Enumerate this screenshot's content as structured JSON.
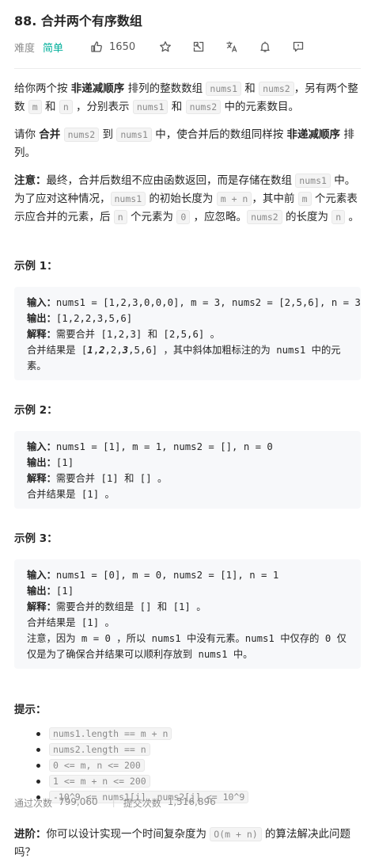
{
  "problem": {
    "title": "88. 合并两个有序数组",
    "difficulty_label": "难度",
    "difficulty": "简单",
    "likes": "1650"
  },
  "desc": {
    "p1": [
      "给你两个按 ",
      "非递减顺序",
      " 排列的整数数组 ",
      "nums1",
      " 和 ",
      "nums2",
      "，另有两个整数 ",
      "m",
      " 和 ",
      "n",
      " ，分别表示 ",
      "nums1",
      " 和 ",
      "nums2",
      " 中的元素数目。"
    ],
    "p2": [
      "请你 ",
      "合并",
      " ",
      "nums2",
      " 到 ",
      "nums1",
      " 中，使合并后的数组同样按 ",
      "非递减顺序",
      " 排列。"
    ],
    "p3": [
      "注意：",
      "最终，合并后数组不应由函数返回，而是存储在数组 ",
      "nums1",
      " 中。为了应对这种情况，",
      "nums1",
      " 的初始长度为 ",
      "m + n",
      "，其中前 ",
      "m",
      " 个元素表示应合并的元素，后 ",
      "n",
      " 个元素为 ",
      "0",
      " ，应忽略。",
      "nums2",
      " 的长度为 ",
      "n",
      " 。"
    ]
  },
  "examples": [
    {
      "heading": "示例 1：",
      "input_label": "输入：",
      "input": "nums1 = [1,2,3,0,0,0], m = 3, nums2 = [2,5,6], n = 3",
      "output_label": "输出：",
      "output": "[1,2,2,3,5,6]",
      "explain_label": "解释：",
      "explain": "需要合并 [1,2,3] 和 [2,5,6] 。",
      "extra": "合并结果是 [",
      "merged_bold": [
        "1",
        "2"
      ],
      "merged_mid": ",2,",
      "merged_bold2": "3",
      "merged_tail": ",5,6] ，其中斜体加粗标注的为 nums1 中的元素。"
    },
    {
      "heading": "示例 2：",
      "input_label": "输入：",
      "input": "nums1 = [1], m = 1, nums2 = [], n = 0",
      "output_label": "输出：",
      "output": "[1]",
      "explain_label": "解释：",
      "explain": "需要合并 [1] 和 [] 。",
      "extra": "合并结果是 [1] 。"
    },
    {
      "heading": "示例 3：",
      "input_label": "输入：",
      "input": "nums1 = [0], m = 0, nums2 = [1], n = 1",
      "output_label": "输出：",
      "output": "[1]",
      "explain_label": "解释：",
      "explain": "需要合并的数组是 [] 和 [1] 。",
      "extra": "合并结果是 [1] 。",
      "note": "注意，因为 m = 0 ，所以 nums1 中没有元素。nums1 中仅存的 0 仅仅是为了确保合并结果可以顺利存放到 nums1 中。"
    }
  ],
  "hints": {
    "heading": "提示：",
    "items": [
      "nums1.length == m + n",
      "nums2.length == n",
      "0 <= m, n <= 200",
      "1 <= m + n <= 200",
      "-10^9 <= nums1[i], nums2[j] <= 10^9"
    ]
  },
  "advance": {
    "label": "进阶：",
    "text1": "你可以设计实现一个时间复杂度为 ",
    "code": "O(m + n)",
    "text2": " 的算法解决此问题吗？"
  },
  "footer": {
    "accepted_label": "通过次数",
    "accepted": "799,060",
    "submitted_label": "提交次数",
    "submitted": "1,516,896"
  }
}
